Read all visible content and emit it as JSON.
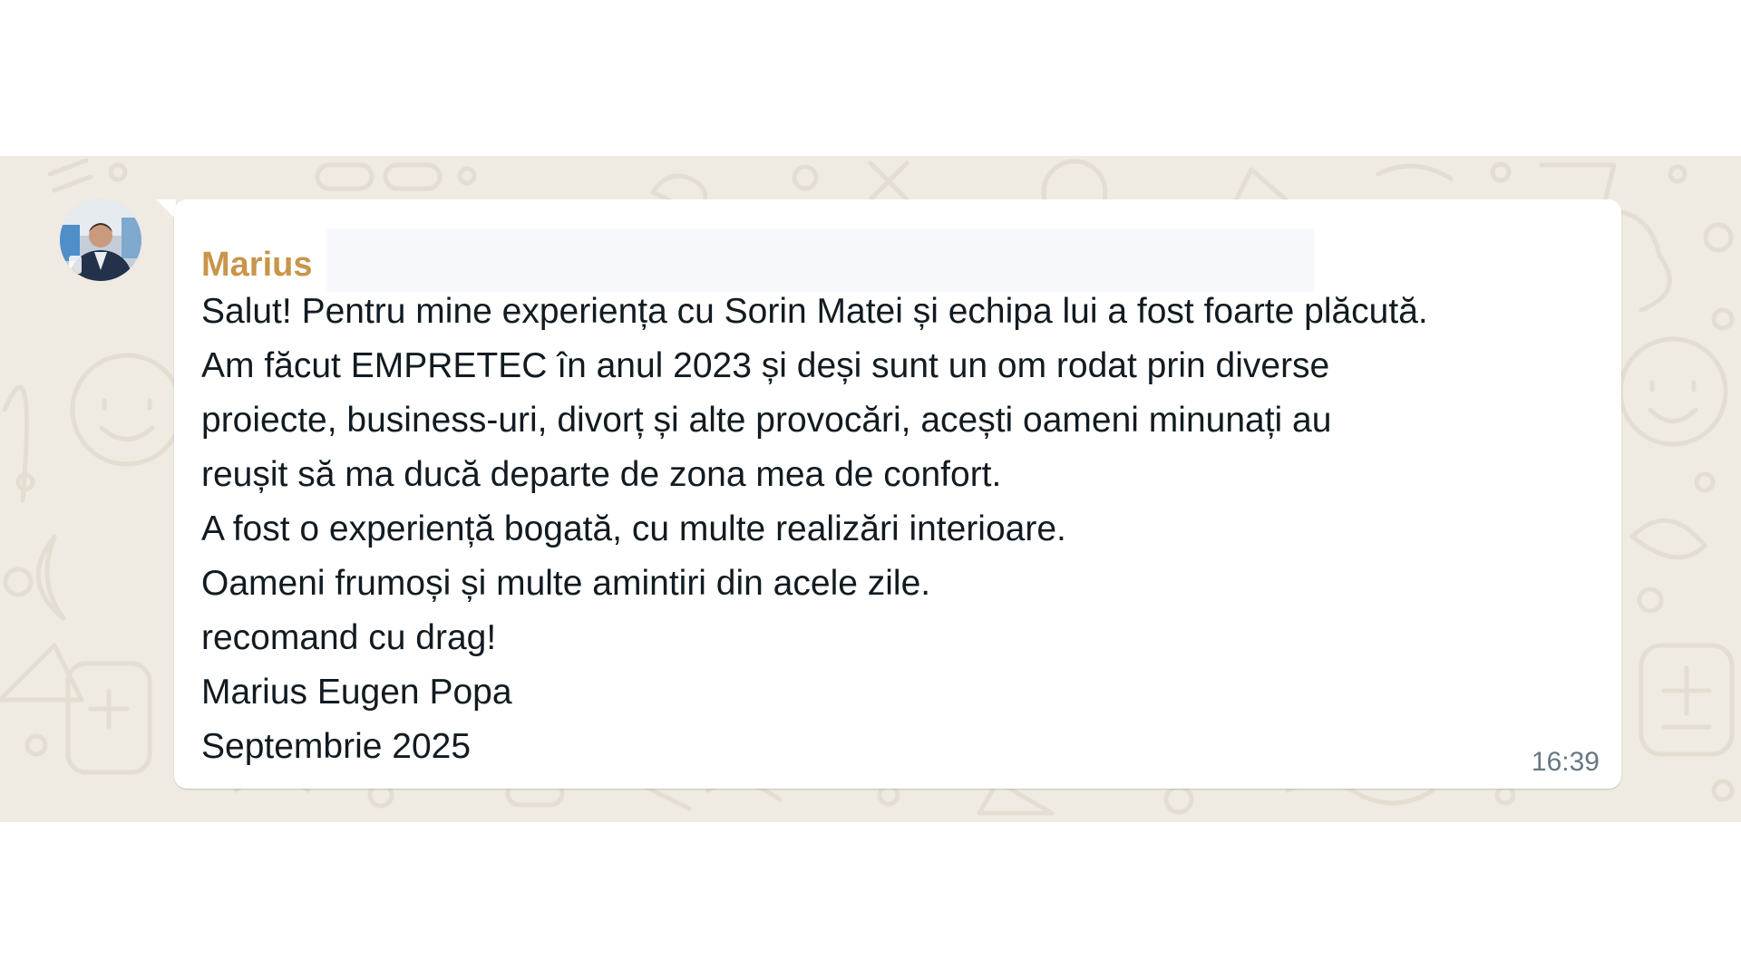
{
  "chat": {
    "background_color": "#efeae2",
    "bubble_color": "#ffffff",
    "message": {
      "sender": "Marius",
      "sender_color": "#c9954a",
      "lines": [
        "Salut! Pentru mine experiența cu Sorin Matei și echipa lui a fost foarte plăcută.",
        "Am făcut EMPRETEC în anul 2023 și deși sunt un om rodat prin diverse",
        "proiecte, business-uri, divorț și alte provocări, acești oameni minunați au",
        "reușit să ma ducă departe de zona mea de confort.",
        "A fost o experiență bogată, cu multe realizări interioare.",
        "Oameni frumoși și multe amintiri din acele zile.",
        "recomand cu drag!",
        "Marius Eugen Popa",
        "Septembrie 2025"
      ],
      "time": "16:39"
    },
    "avatar_icon": "profile-photo"
  }
}
